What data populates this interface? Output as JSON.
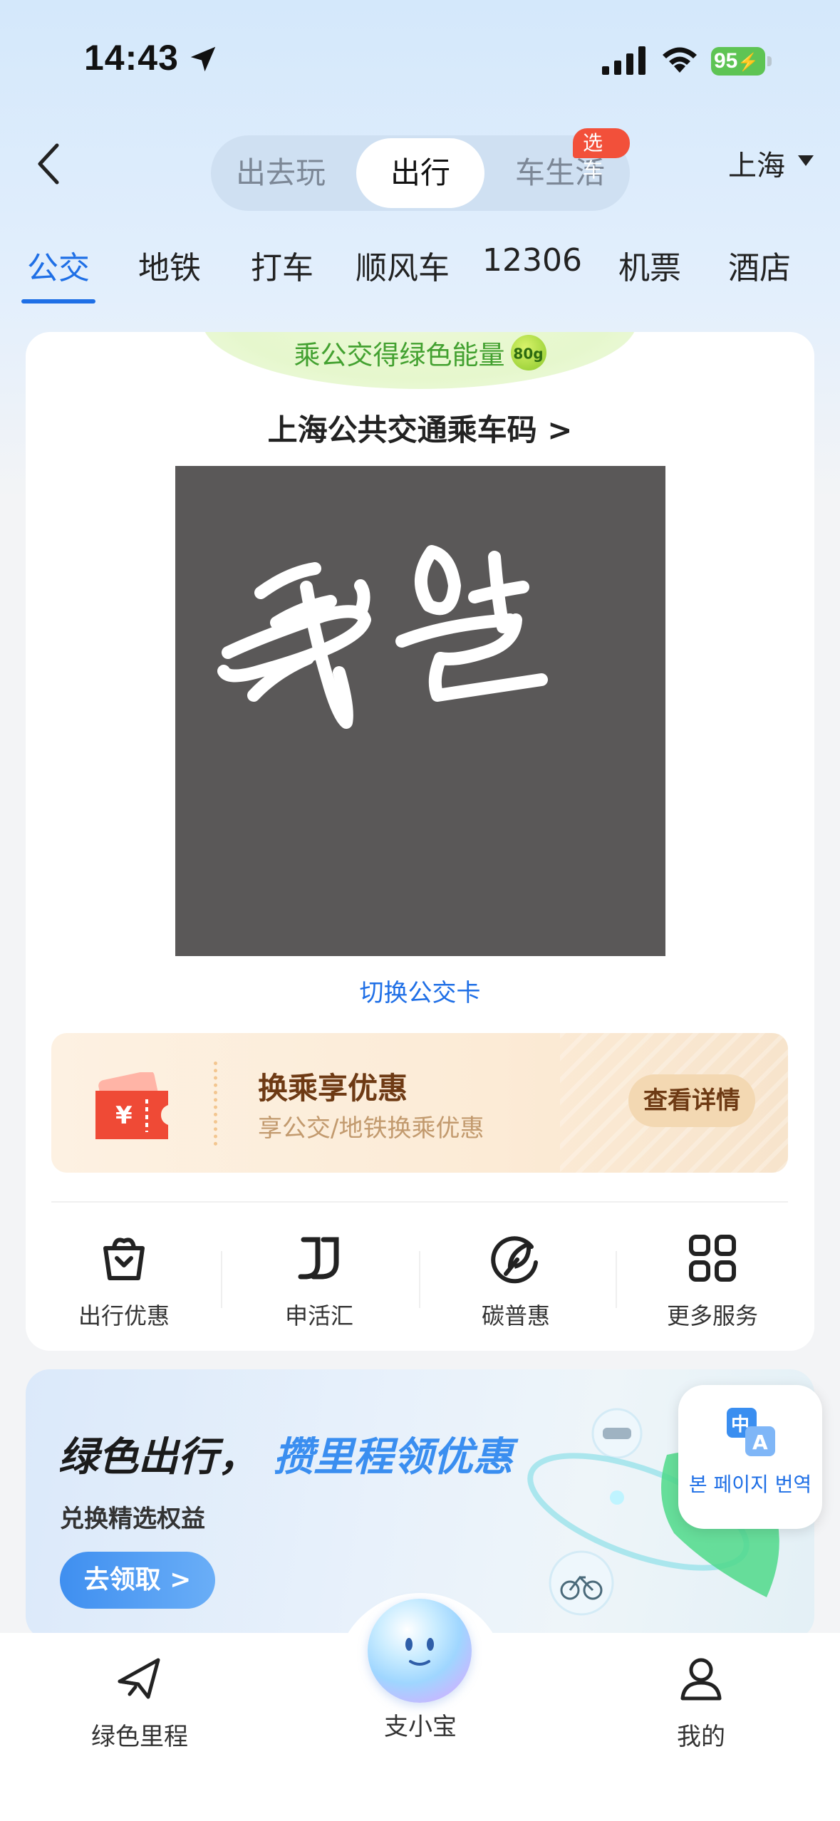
{
  "status_bar": {
    "time": "14:43",
    "battery": "95"
  },
  "header": {
    "segments": [
      "出去玩",
      "出行",
      "车生活"
    ],
    "active_segment": "出行",
    "badge": "选车",
    "city": "上海"
  },
  "category_tabs": [
    "公交",
    "地铁",
    "打车",
    "顺风车",
    "12306",
    "机票",
    "酒店"
  ],
  "active_category": "公交",
  "card": {
    "green_energy_text": "乘公交得绿色能量",
    "energy_amount": "80g",
    "title": "上海公共交通乘车码 >",
    "switch_card": "切换公交卡"
  },
  "promo": {
    "title": "换乘享优惠",
    "subtitle": "享公交/地铁换乘优惠",
    "button": "查看详情"
  },
  "services": [
    {
      "label": "出行优惠",
      "icon": "gift-bag-icon"
    },
    {
      "label": "申活汇",
      "icon": "shenhuohui-logo-icon"
    },
    {
      "label": "碳普惠",
      "icon": "carbon-leaf-icon"
    },
    {
      "label": "更多服务",
      "icon": "grid-icon"
    }
  ],
  "green_banner": {
    "title_black": "绿色出行，",
    "title_blue": "攒里程领优惠",
    "subtitle": "兑换精选权益",
    "button": "去领取 >"
  },
  "translate": {
    "label": "본 페이지 번역"
  },
  "bottom_nav": {
    "left": "绿色里程",
    "center": "支小宝",
    "right": "我的"
  },
  "colors": {
    "accent": "#1f6fe6",
    "green": "#43a130",
    "badge": "#f2503a"
  }
}
